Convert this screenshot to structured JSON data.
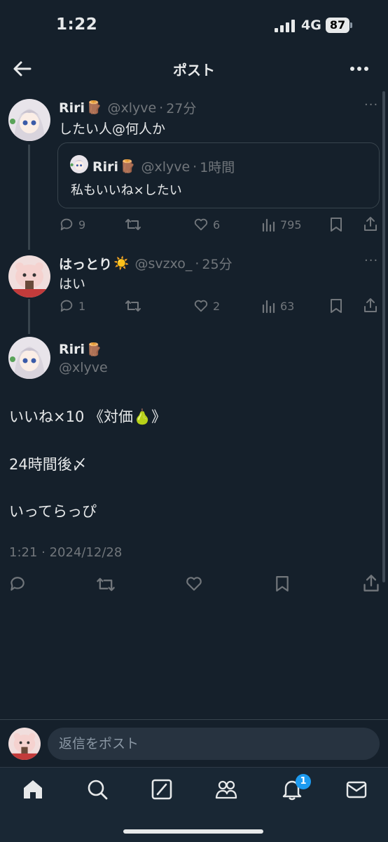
{
  "status_bar": {
    "time": "1:22",
    "network": "4G",
    "battery": "87"
  },
  "header": {
    "title": "ポスト"
  },
  "thread": [
    {
      "name": "Riri",
      "emoji": "🪵",
      "handle": "@xlyve",
      "time": "27分",
      "text": "したい人@何人か",
      "quote": {
        "name": "Riri",
        "emoji": "🪵",
        "handle": "@xlyve",
        "time": "1時間",
        "text": "私もいいね×したい"
      },
      "stats": {
        "replies": "9",
        "likes": "6",
        "views": "795"
      }
    },
    {
      "name": "はっとり",
      "emoji": "☀️",
      "handle": "@svzxo_",
      "time": "25分",
      "text": "はい",
      "stats": {
        "replies": "1",
        "likes": "2",
        "views": "63"
      }
    }
  ],
  "main_post": {
    "name": "Riri",
    "emoji": "🪵",
    "handle": "@xlyve",
    "line1": "いいね×10 《対価🍐》",
    "line2": "24時間後〆",
    "line3": "いってらっぴ",
    "timestamp": "1:21 · 2024/12/28"
  },
  "reply_bar": {
    "placeholder": "返信をポスト"
  },
  "tabbar": {
    "notifications_badge": "1"
  },
  "colors": {
    "background": "#15202b",
    "accent": "#1d9bf0",
    "muted": "#71767b"
  }
}
